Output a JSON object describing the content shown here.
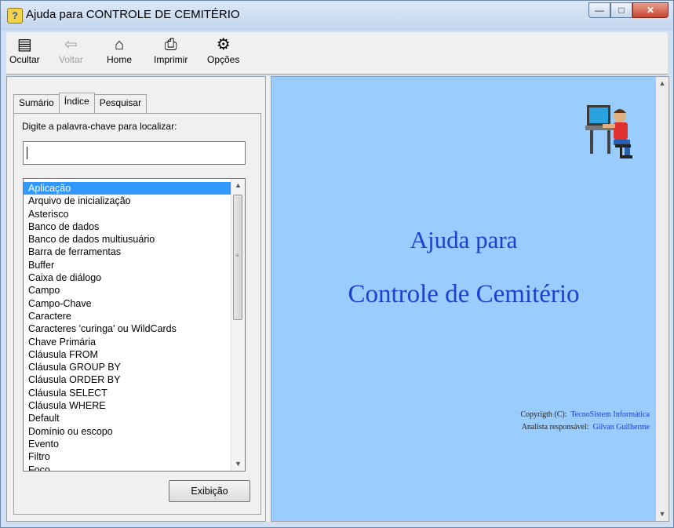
{
  "window": {
    "title": "Ajuda para CONTROLE DE CEMITÉRIO",
    "minimize_glyph": "—",
    "maximize_glyph": "□",
    "close_glyph": "✕"
  },
  "toolbar": {
    "hide_label": "Ocultar",
    "back_label": "Voltar",
    "home_label": "Home",
    "print_label": "Imprimir",
    "options_label": "Opções"
  },
  "tabs": {
    "contents": "Sumário",
    "index": "Índice",
    "search": "Pesquisar"
  },
  "index": {
    "prompt": "Digite a palavra-chave para localizar:",
    "search_value": "",
    "items": [
      "Aplicação",
      "Arquivo de inicialização",
      "Asterisco",
      "Banco de dados",
      "Banco de dados multiusuário",
      "Barra de ferramentas",
      "Buffer",
      "Caixa de diálogo",
      "Campo",
      "Campo-Chave",
      "Caractere",
      "Caracteres 'curinga' ou WildCards",
      "Chave Primária",
      "Cláusula FROM",
      "Cláusula GROUP BY",
      "Cláusula ORDER BY",
      "Cláusula SELECT",
      "Cláusula WHERE",
      "Default",
      "Domínio ou escopo",
      "Evento",
      "Filtro",
      "Foco"
    ],
    "selected_index": 0,
    "show_button": "Exibição"
  },
  "content": {
    "heading1": "Ajuda para",
    "heading2": "Controle de Cemitério",
    "copyright_label": "Copyrigth (C):",
    "copyright_value": "TecnoSistem Informática",
    "analyst_label": "Analista responsável:",
    "analyst_value": "Gilvan Guilherme"
  },
  "colors": {
    "content_background": "#99ccff",
    "heading": "#1f3fcf",
    "selection": "#3399ff"
  },
  "icons": [
    "help-book-icon",
    "hide-icon",
    "back-arrow-icon",
    "home-icon",
    "printer-icon",
    "options-icon",
    "computer-user-illustration"
  ]
}
